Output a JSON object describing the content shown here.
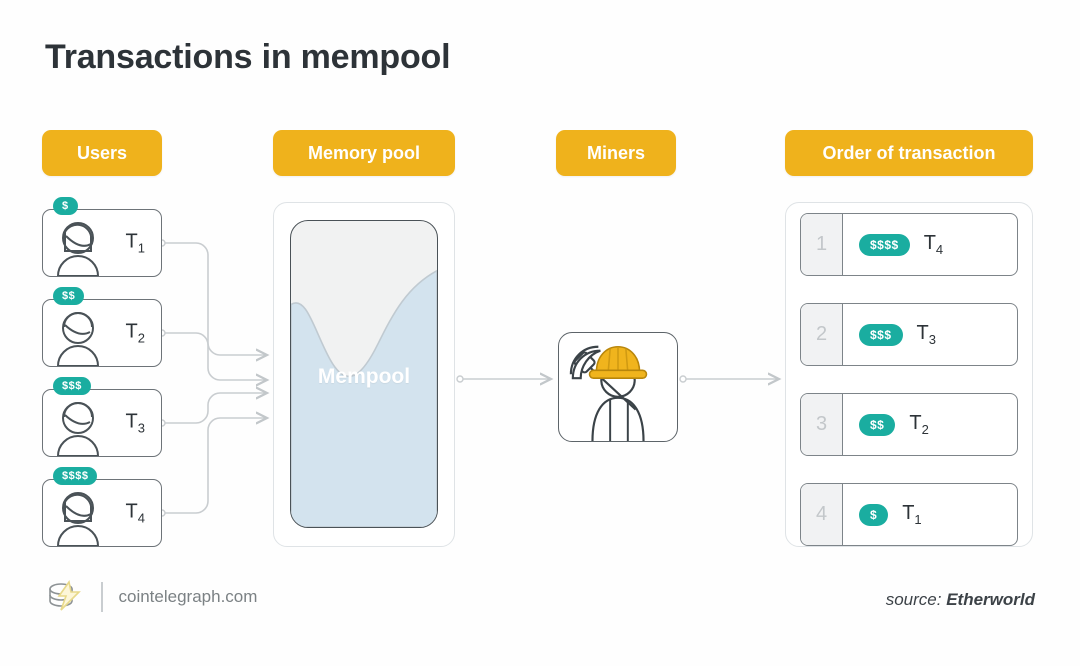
{
  "title": "Transactions in mempool",
  "headers": {
    "users": "Users",
    "memory_pool": "Memory pool",
    "miners": "Miners",
    "order": "Order of transaction"
  },
  "colors": {
    "header_pill": "#efb21c",
    "fee_badge": "#1aada0",
    "liquid": "#d3e3ee",
    "helmet": "#f0b41d",
    "title_text": "#2d3338"
  },
  "users": [
    {
      "fee": "$",
      "tx": "T",
      "index": "1",
      "avatar": "avatar-long-hair"
    },
    {
      "fee": "$$",
      "tx": "T",
      "index": "2",
      "avatar": "avatar-short-hair"
    },
    {
      "fee": "$$$",
      "tx": "T",
      "index": "3",
      "avatar": "avatar-short-hair"
    },
    {
      "fee": "$$$$",
      "tx": "T",
      "index": "4",
      "avatar": "avatar-long-hair"
    }
  ],
  "mempool": {
    "label": "Mempool"
  },
  "miner": {
    "icon": "miner-with-pickaxe-icon"
  },
  "order_rows": [
    {
      "rank": "1",
      "fee": "$$$$",
      "tx": "T",
      "index": "4"
    },
    {
      "rank": "2",
      "fee": "$$$",
      "tx": "T",
      "index": "3"
    },
    {
      "rank": "3",
      "fee": "$$",
      "tx": "T",
      "index": "2"
    },
    {
      "rank": "4",
      "fee": "$",
      "tx": "T",
      "index": "1"
    }
  ],
  "footer": {
    "brand_url": "cointelegraph.com",
    "source_prefix": "source:",
    "source_name": "Etherworld"
  }
}
